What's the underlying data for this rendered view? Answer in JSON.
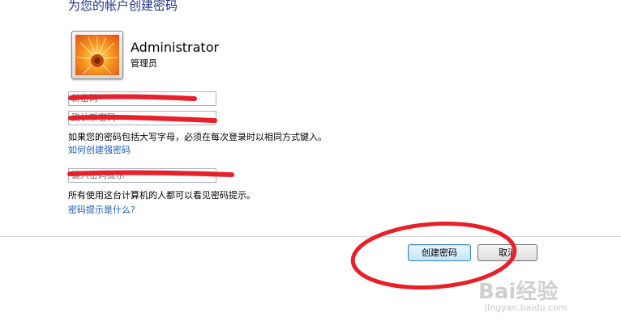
{
  "header": {
    "title": "为您的帐户创建密码"
  },
  "user": {
    "name": "Administrator",
    "role": "管理员"
  },
  "form": {
    "new_password_placeholder": "新密码",
    "confirm_password_placeholder": "确认新密码",
    "caps_note": "如果您的密码包括大写字母，必须在每次登录时以相同方式键入。",
    "strong_password_link": "如何创建强密码",
    "hint_placeholder": "键入密码提示",
    "hint_note": "所有使用这台计算机的人都可以看见密码提示。",
    "hint_help_link": "密码提示是什么?"
  },
  "actions": {
    "create_label": "创建密码",
    "cancel_label": "取消"
  },
  "annotations": {
    "mark_color": "#e8202a"
  },
  "watermark": {
    "logo": "Bai经验",
    "url": "jingyan.baidu.com"
  }
}
